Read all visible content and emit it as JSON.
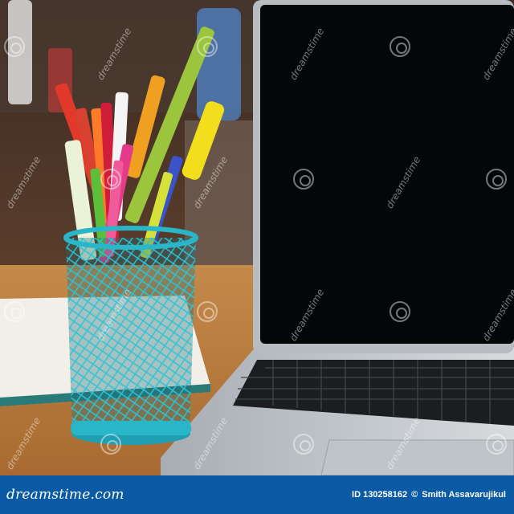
{
  "watermark": {
    "text": "dreamstime"
  },
  "footer": {
    "brand": "dreamstime.com",
    "id_text": "ID 130258162",
    "copyright_symbol": "©",
    "author": "Smith Assavarujikul"
  },
  "colors": {
    "footer_bg": "#0b5aa5",
    "holder": "#29b6c9",
    "laptop_screen": "#050608"
  }
}
